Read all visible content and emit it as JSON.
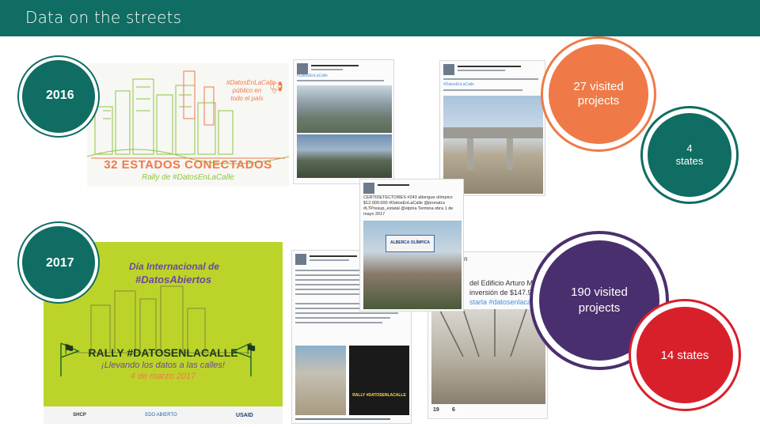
{
  "header": {
    "title": "Data on the streets"
  },
  "years": {
    "y2016": "2016",
    "y2017": "2017"
  },
  "stats": {
    "visited_2016": "27 visited projects",
    "states_2016": "4 states",
    "visited_2017": "190 visited projects",
    "states_2017": "14 states"
  },
  "poster_2016": {
    "title": "32 ESTADOS CONECTADOS",
    "subtitle": "Rally de #DatosEnLaCalle",
    "bubble": "#DatosEnLaCalle público en todo el país"
  },
  "poster_2017": {
    "line1": "Día Internacional de",
    "line2": "#DatosAbiertos",
    "title": "RALLY #DATOSENLACALLE",
    "subtitle": "¡Llevando los datos a las calles!",
    "date": "4 de marzo 2017",
    "logos": [
      "SHCP",
      "EDO ABIERTO",
      "USAID"
    ]
  },
  "tweets": {
    "a_tag": "#DatosEnLaCalle",
    "b_tag": "#DatosEnLaCalle",
    "c_text": "CERTIDETECTORES #243 albergue olímpico $12.000.000 #DatosEnLaCalle @pronatcs #LTPresup_estatal @elpina Termina obra 1 de mayo 2017",
    "c_sign": "ALBERCA OLÍMPICA",
    "d_sign": "RALLY #DATOSENLACALLE",
    "e_lines": [
      "gación",
      "del Edificio Arturo Mun",
      "inversión de $147.9 m",
      "starla #datosenlacalle"
    ],
    "e_stats": [
      "19",
      "6"
    ]
  },
  "colors": {
    "teal": "#0f6d63",
    "orange": "#ef7a47",
    "purple": "#4a2f6e",
    "red": "#d8202b",
    "lime": "#bcd42a"
  }
}
